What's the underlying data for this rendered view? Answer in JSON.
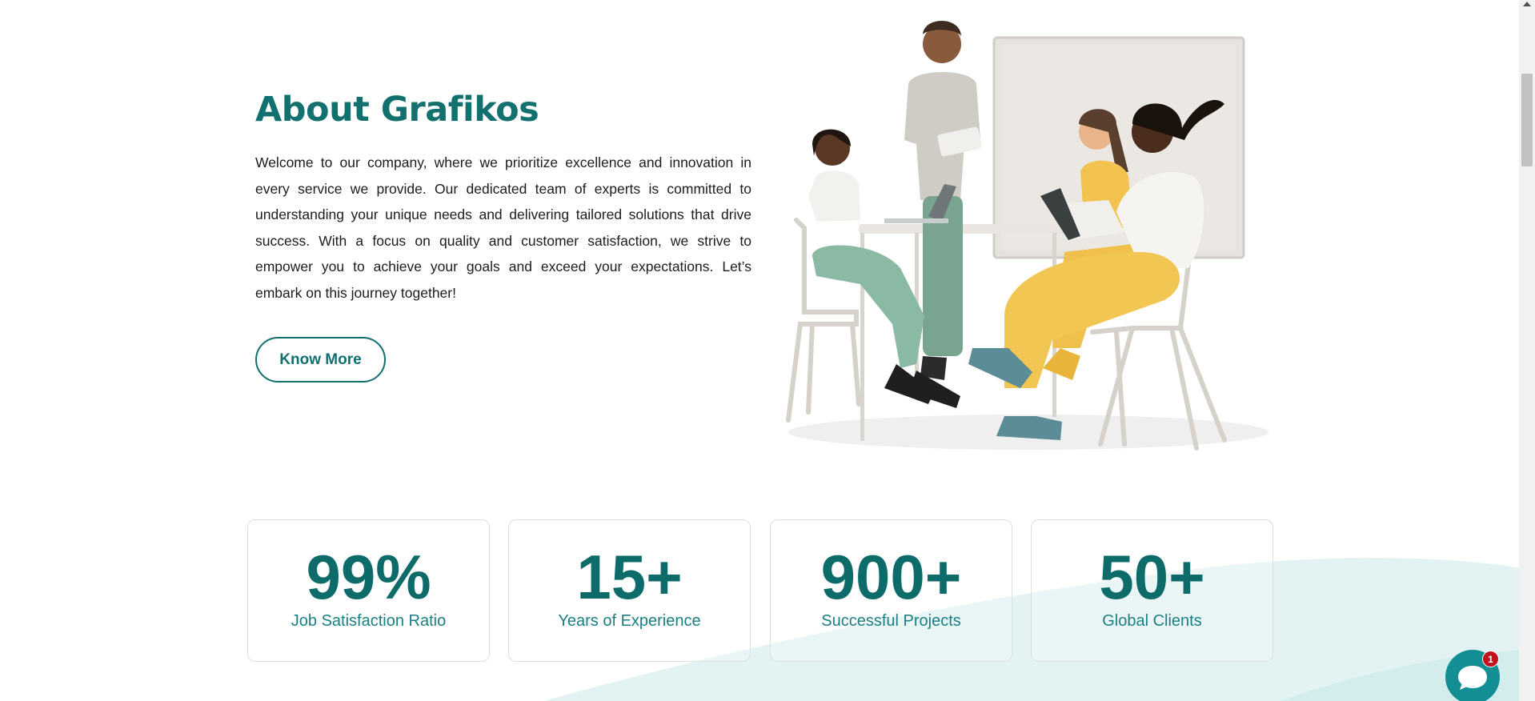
{
  "about": {
    "title": "About Grafikos",
    "body": "Welcome to our company, where we prioritize excellence and innovation in every service we provide. Our dedicated team of experts is committed to understanding your unique needs and delivering tailored solutions that drive success. With a focus on quality and customer satisfaction, we strive to empower you to achieve your goals and exceed your expectations. Let’s embark on this journey together!",
    "button_label": "Know More"
  },
  "stats": [
    {
      "value": "99%",
      "label": "Job Satisfaction Ratio"
    },
    {
      "value": "15+",
      "label": "Years of Experience"
    },
    {
      "value": "900+",
      "label": "Successful Projects"
    },
    {
      "value": "50+",
      "label": "Global Clients"
    }
  ],
  "chat": {
    "badge_count": "1",
    "icon": "chat-bubble-icon"
  },
  "colors": {
    "brand_teal": "#12706f",
    "stat_label": "#1b7f82",
    "wave": "#e3f3f3",
    "chat": "#138e94",
    "badge": "#c0121b"
  }
}
